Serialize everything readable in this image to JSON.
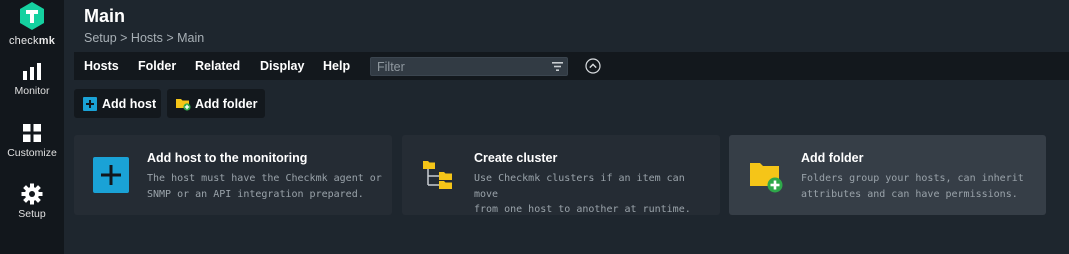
{
  "sidebar": {
    "logo": {
      "text_plain": "check",
      "text_bold": "mk",
      "color": "#15d1a0"
    },
    "items": [
      {
        "label": "Monitor",
        "icon": "monitor-icon"
      },
      {
        "label": "Customize",
        "icon": "customize-icon"
      },
      {
        "label": "Setup",
        "icon": "setup-gear-icon"
      }
    ]
  },
  "header": {
    "title": "Main",
    "breadcrumb": [
      "Setup",
      "Hosts",
      "Main"
    ],
    "breadcrumb_separator": " > "
  },
  "menubar": {
    "items": [
      "Hosts",
      "Folder",
      "Related",
      "Display",
      "Help"
    ],
    "filter_placeholder": "Filter",
    "filter_icon": "filter-icon",
    "collapse_icon": "chevron-up-circle-icon"
  },
  "actions": [
    {
      "label": "Add host",
      "icon": "add-host-icon"
    },
    {
      "label": "Add folder",
      "icon": "add-folder-icon"
    }
  ],
  "cards": [
    {
      "title": "Add host to the monitoring",
      "desc_lines": [
        "The host must have the Checkmk agent or",
        "SNMP or an API integration prepared."
      ],
      "icon": "add-host-plus-icon"
    },
    {
      "title": "Create cluster",
      "desc_lines": [
        "Use Checkmk clusters if an item can move",
        "from one host to another at runtime."
      ],
      "icon": "cluster-folders-icon"
    },
    {
      "title": "Add folder",
      "desc_lines": [
        "Folders group your hosts, can inherit",
        "attributes and can have permissions."
      ],
      "icon": "folder-plus-icon"
    }
  ],
  "colors": {
    "background": "#1e262e",
    "sidebar": "#12171c",
    "menubar": "#13181d",
    "card": "#252c34",
    "card_active": "#363e47",
    "accent_blue": "#1aa2d6",
    "folder_yellow": "#f5c518",
    "green_plus": "#2ea84a"
  }
}
